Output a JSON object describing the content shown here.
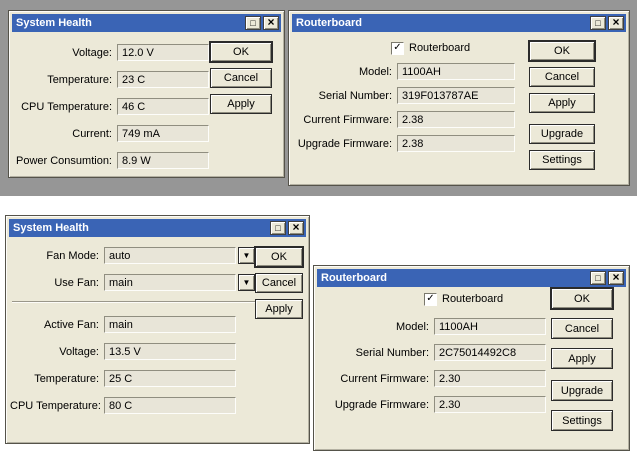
{
  "colors": {
    "titlebar": "#3a64b5",
    "titlebar_text": "#ffffff",
    "window_bg": "#ece9d8",
    "field_bg": "#e8e5d8",
    "desktop_top": "#969696",
    "desktop_bottom": "#ffffff"
  },
  "icons": {
    "maximize": "□",
    "close": "×",
    "dropdown": "▼",
    "check": "✓"
  },
  "health_top": {
    "title": "System Health",
    "fields": [
      {
        "label": "Voltage:",
        "value": "12.0 V"
      },
      {
        "label": "Temperature:",
        "value": "23 C"
      },
      {
        "label": "CPU Temperature:",
        "value": "46 C"
      },
      {
        "label": "Current:",
        "value": "749 mA"
      },
      {
        "label": "Power Consumtion:",
        "value": "8.9 W"
      }
    ],
    "buttons": {
      "ok": "OK",
      "cancel": "Cancel",
      "apply": "Apply"
    }
  },
  "routerboard_top": {
    "title": "Routerboard",
    "checkbox_label": "Routerboard",
    "checkbox_checked": true,
    "fields": [
      {
        "label": "Model:",
        "value": "1100AH"
      },
      {
        "label": "Serial Number:",
        "value": "319F013787AE"
      },
      {
        "label": "Current Firmware:",
        "value": "2.38"
      },
      {
        "label": "Upgrade Firmware:",
        "value": "2.38"
      }
    ],
    "buttons": {
      "ok": "OK",
      "cancel": "Cancel",
      "apply": "Apply",
      "upgrade": "Upgrade",
      "settings": "Settings"
    }
  },
  "health_bottom": {
    "title": "System Health",
    "dropdowns": [
      {
        "label": "Fan Mode:",
        "value": "auto"
      },
      {
        "label": "Use Fan:",
        "value": "main"
      }
    ],
    "fields": [
      {
        "label": "Active Fan:",
        "value": "main"
      },
      {
        "label": "Voltage:",
        "value": "13.5 V"
      },
      {
        "label": "Temperature:",
        "value": "25 C"
      },
      {
        "label": "CPU Temperature:",
        "value": "80 C"
      }
    ],
    "buttons": {
      "ok": "OK",
      "cancel": "Cancel",
      "apply": "Apply"
    }
  },
  "routerboard_bottom": {
    "title": "Routerboard",
    "checkbox_label": "Routerboard",
    "checkbox_checked": true,
    "fields": [
      {
        "label": "Model:",
        "value": "1100AH"
      },
      {
        "label": "Serial Number:",
        "value": "2C75014492C8"
      },
      {
        "label": "Current Firmware:",
        "value": "2.30"
      },
      {
        "label": "Upgrade Firmware:",
        "value": "2.30"
      }
    ],
    "buttons": {
      "ok": "OK",
      "cancel": "Cancel",
      "apply": "Apply",
      "upgrade": "Upgrade",
      "settings": "Settings"
    }
  }
}
